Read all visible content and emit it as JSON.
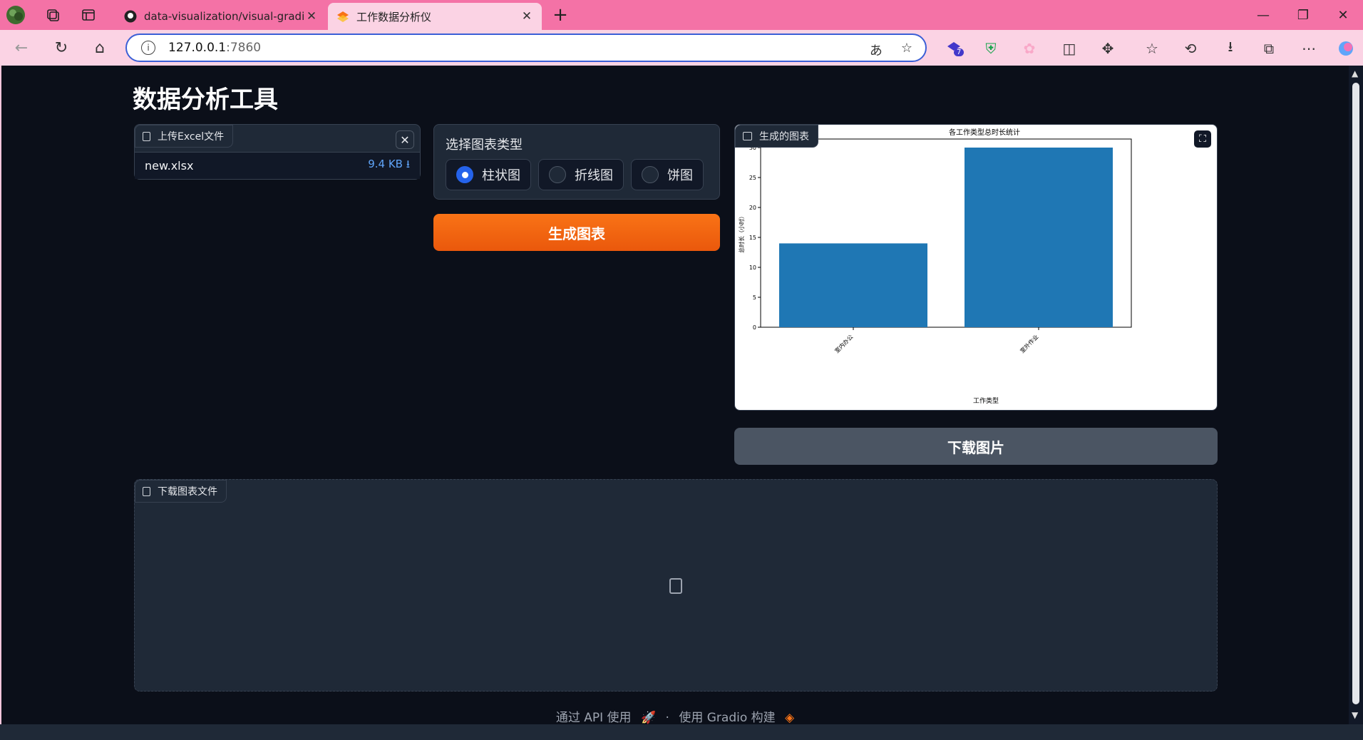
{
  "browser": {
    "tabs": [
      {
        "title": "data-visualization/visual-gradio.p",
        "close": "✕"
      },
      {
        "title": "工作数据分析仪",
        "close": "✕"
      }
    ],
    "new_tab": "+",
    "window_controls": {
      "minimize": "—",
      "restore": "❐",
      "close": "✕"
    },
    "address": {
      "host": "127.0.0.1",
      "port": ":7860"
    },
    "extension_badge": "7"
  },
  "app": {
    "title": "数据分析工具",
    "upload": {
      "label": "上传Excel文件",
      "file_name": "new.xlsx",
      "file_size": "9.4 KB ⭳",
      "close": "✕"
    },
    "chart_type": {
      "label": "选择图表类型",
      "options": [
        "柱状图",
        "折线图",
        "饼图"
      ],
      "selected": "柱状图"
    },
    "generate_button": "生成图表",
    "chart_panel": {
      "label": "生成的图表",
      "fullscreen": "⛶"
    },
    "download_image_button": "下载图片",
    "download_file": {
      "label": "下载图表文件"
    },
    "footer": {
      "api": "通过 API 使用",
      "sep": "·",
      "built": "使用 Gradio 构建"
    }
  },
  "chart_data": {
    "type": "bar",
    "title": "各工作类型总时长统计",
    "xlabel": "工作类型",
    "ylabel": "总时长（小时）",
    "categories": [
      "室内办公",
      "室外作业"
    ],
    "values": [
      14,
      30
    ],
    "ylim": [
      0,
      30
    ],
    "yticks": [
      0,
      5,
      10,
      15,
      20,
      25,
      30
    ],
    "color": "#1f77b4",
    "grid": false
  },
  "colors": {
    "page_bg": "#0b0f19",
    "accent_orange": "#f97316",
    "radio_selected": "#2563eb",
    "tabbar": "#f472a6"
  }
}
